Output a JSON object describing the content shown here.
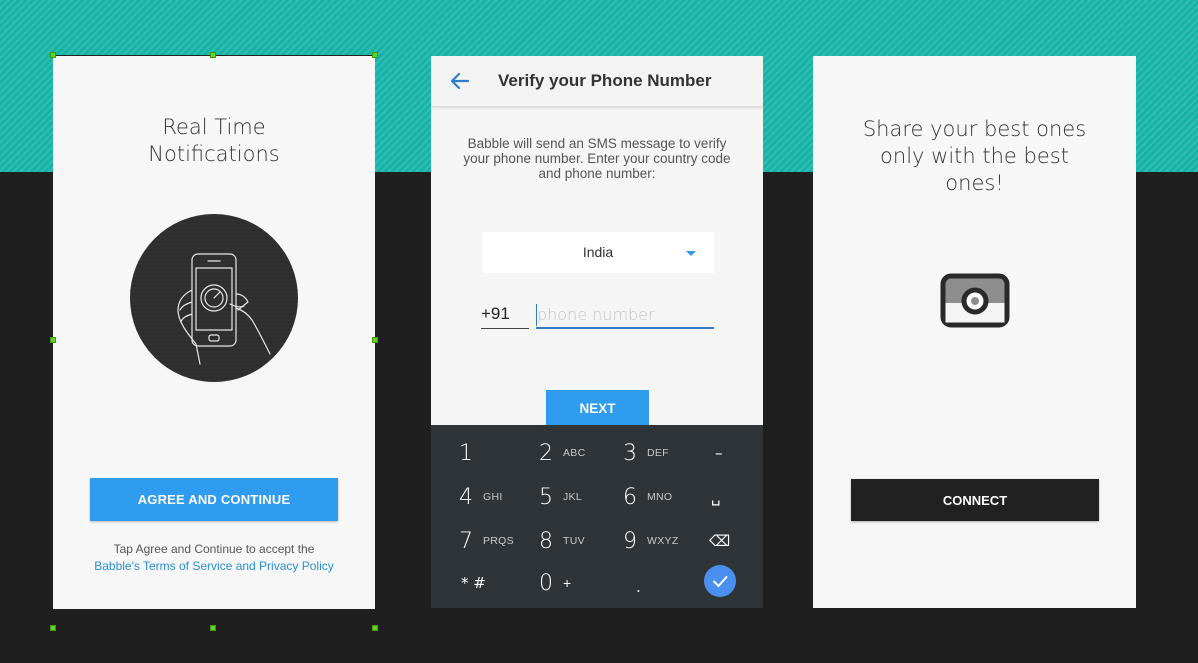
{
  "panel1": {
    "title_line1": "Real Time",
    "title_line2": "Notifications",
    "agree_button": "AGREE AND CONTINUE",
    "terms_line1": "Tap Agree and Continue to accept the",
    "terms_link": "Babble's Terms of Service and Privacy Policy",
    "illustration_icon": "hand-holding-phone-illustration"
  },
  "panel2": {
    "appbar_title": "Verify your Phone Number",
    "back_icon": "arrow-left-icon",
    "description": "Babble will send an SMS message to verify your phone number. Enter your country code and phone number:",
    "country": "India",
    "country_code": "+91",
    "phone_placeholder": "phone number",
    "next_button": "NEXT",
    "keyboard": {
      "rows": [
        [
          {
            "main": "1",
            "sub": ""
          },
          {
            "main": "2",
            "sub": "ABC"
          },
          {
            "main": "3",
            "sub": "DEF"
          },
          {
            "main": "–",
            "sub": ""
          }
        ],
        [
          {
            "main": "4",
            "sub": "GHI"
          },
          {
            "main": "5",
            "sub": "JKL"
          },
          {
            "main": "6",
            "sub": "MNO"
          },
          {
            "main": "␣",
            "sub": ""
          }
        ],
        [
          {
            "main": "7",
            "sub": "PRQS"
          },
          {
            "main": "8",
            "sub": "TUV"
          },
          {
            "main": "9",
            "sub": "WXYZ"
          },
          {
            "main": "⌫",
            "sub": ""
          }
        ],
        [
          {
            "main": "* #",
            "sub": ""
          },
          {
            "main": "0",
            "sub": "+"
          },
          {
            "main": ".",
            "sub": ""
          },
          {
            "main": "✓",
            "sub": ""
          }
        ]
      ]
    }
  },
  "panel3": {
    "title_line1": "Share your best ones",
    "title_line2": "only with the best",
    "title_line3": "ones!",
    "connect_button": "CONNECT",
    "camera_icon": "camera-icon"
  },
  "colors": {
    "accent_blue": "#2f9cf0",
    "teal_background": "#16b3a7",
    "dark_background": "#1f1f1f",
    "keyboard_background": "#2f3438",
    "selection_handle": "#62d21b"
  }
}
